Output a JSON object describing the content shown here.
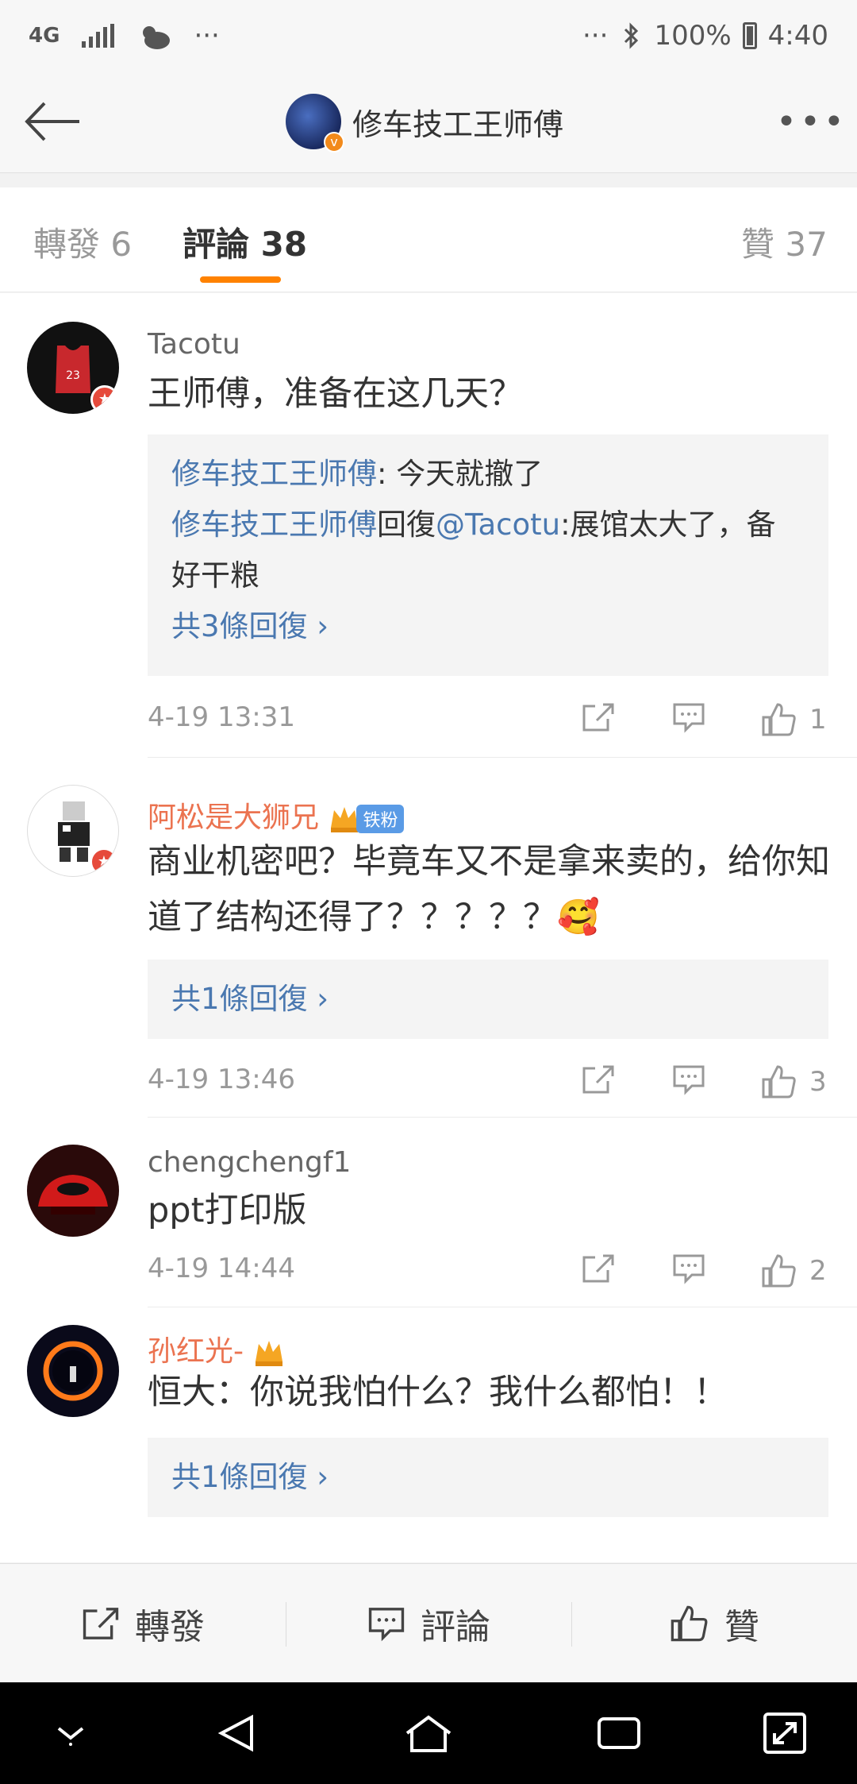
{
  "status": {
    "network": "4G",
    "dots": "···",
    "right_dots": "···",
    "battery": "100%",
    "time": "4:40"
  },
  "nav": {
    "title": "修车技工王师傅",
    "more": "•••"
  },
  "tabs": {
    "repost": "轉發 6",
    "comments": "評論 38",
    "likes": "贊 37"
  },
  "comments": [
    {
      "user": "Tacotu",
      "text": "王师傅，准备在这几天？",
      "replies": [
        {
          "name": "修车技工王师傅",
          "text": ": 今天就撤了"
        },
        {
          "name": "修车技工王师傅",
          "mid": "回復",
          "mention": "@Tacotu",
          "text": ":展馆太大了，备好干粮"
        }
      ],
      "more": "共3條回復 ›",
      "time": "4-19 13:31",
      "likes": "1"
    },
    {
      "user": "阿松是大狮兄",
      "fan_badge": "铁粉",
      "text": "商业机密吧？毕竟车又不是拿来卖的，给你知道了结构还得了？？？？？🥰",
      "more": "共1條回復 ›",
      "time": "4-19 13:46",
      "likes": "3"
    },
    {
      "user": "chengchengf1",
      "text": "ppt打印版",
      "time": "4-19 14:44",
      "likes": "2"
    },
    {
      "user": "孙红光-",
      "text": "恒大：你说我怕什么？我什么都怕！！",
      "more": "共1條回復 ›"
    }
  ],
  "bottom": {
    "repost": "轉發",
    "comment": "評論",
    "like": "贊"
  },
  "colors": {
    "accent": "#ff8200",
    "link": "#4a78b0",
    "vip_name": "#eb7350"
  }
}
